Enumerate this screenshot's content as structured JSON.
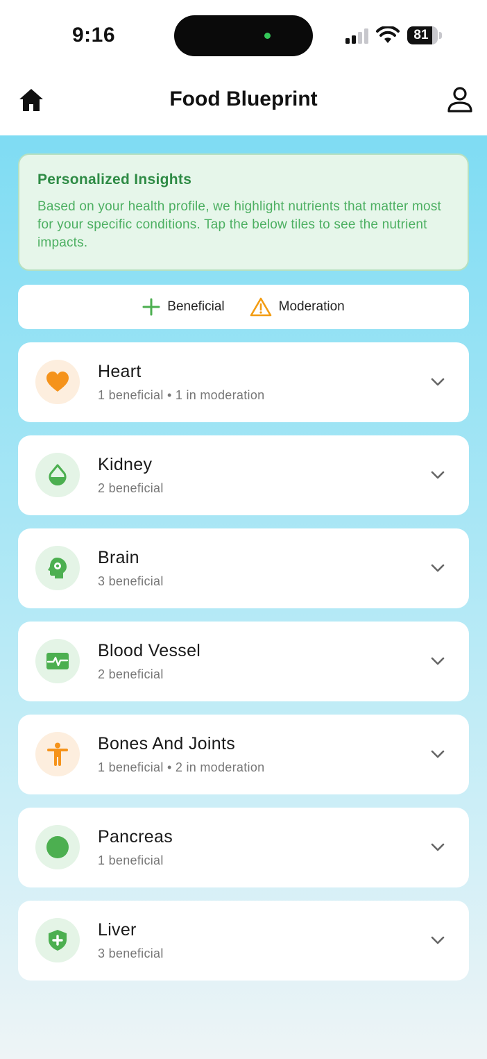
{
  "status_bar": {
    "time": "9:16",
    "battery_level": "81",
    "battery_fraction": 0.81
  },
  "header": {
    "title": "Food Blueprint",
    "left_icon": "home-icon",
    "right_icon": "profile-icon"
  },
  "insights": {
    "title": "Personalized Insights",
    "body": "Based on your health profile, we highlight nutrients that matter most for your specific conditions. Tap the below tiles to see the nutrient impacts."
  },
  "legend": {
    "beneficial_label": "Beneficial",
    "moderation_label": "Moderation",
    "beneficial_icon": "plus-icon",
    "moderation_icon": "warning-icon"
  },
  "colors": {
    "accent_green": "#4caf50",
    "accent_orange": "#f39c12",
    "insight_title": "#2e8b45"
  },
  "organs": [
    {
      "name": "Heart",
      "summary": "1 beneficial • 1 in moderation",
      "icon": "heart-icon",
      "tint": "orange"
    },
    {
      "name": "Kidney",
      "summary": "2 beneficial",
      "icon": "drop-icon",
      "tint": "green"
    },
    {
      "name": "Brain",
      "summary": "3 beneficial",
      "icon": "head-gear-icon",
      "tint": "green"
    },
    {
      "name": "Blood Vessel",
      "summary": "2 beneficial",
      "icon": "pulse-icon",
      "tint": "green"
    },
    {
      "name": "Bones And Joints",
      "summary": "1 beneficial • 2 in moderation",
      "icon": "person-icon",
      "tint": "orange"
    },
    {
      "name": "Pancreas",
      "summary": "1 beneficial",
      "icon": "circle-icon",
      "tint": "green"
    },
    {
      "name": "Liver",
      "summary": "3 beneficial",
      "icon": "shield-plus-icon",
      "tint": "green"
    }
  ]
}
